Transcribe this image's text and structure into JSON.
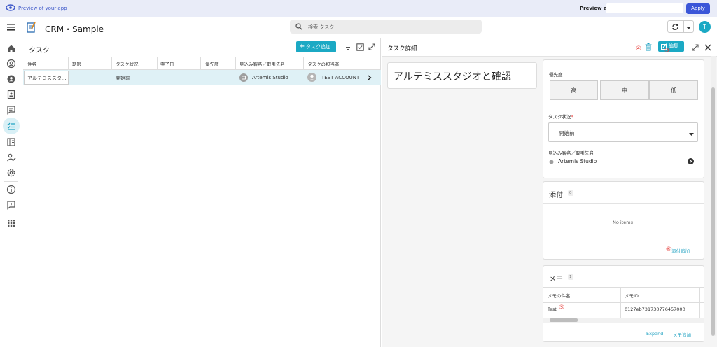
{
  "preview": {
    "text": "Preview of your app",
    "label": "Preview as:",
    "input_value": "",
    "apply": "Apply",
    "accent": "#3b56d8"
  },
  "header": {
    "app_title": "CRM・Sample",
    "search_placeholder": "検索 タスク",
    "avatar_letter": "T",
    "accent": "#1ba9c4"
  },
  "list": {
    "title": "タスク",
    "add_label": "タスク追加",
    "columns": [
      "件名",
      "期限",
      "タスク状況",
      "完了日",
      "優先度",
      "見込み客名／取引先名",
      "タスクの担当者"
    ],
    "rows": [
      {
        "subject": "アルテミススタ...",
        "due": "",
        "status": "開始前",
        "done_date": "",
        "priority": "",
        "account": "Artemis Studio",
        "owner": "TEST ACCOUNT"
      }
    ]
  },
  "detail": {
    "title": "タスク詳細",
    "edit_label": "編集",
    "task_name": "アルテミススタジオと確認",
    "priority_label": "優先度",
    "priority_options": [
      "高",
      "中",
      "低"
    ],
    "status_label": "タスク状況",
    "status_required": "*",
    "status_value": "開始前",
    "account_label": "見込み客名／取引先名",
    "account_value": "Artemis Studio",
    "attach_title": "添付",
    "attach_count": "0",
    "attach_empty": "No items",
    "attach_add": "添付追加",
    "memo_title": "メモ",
    "memo_count": "1",
    "memo_columns": [
      "メモの件名",
      "メモID",
      "\u0000"
    ],
    "memo_rows": [
      {
        "subject": "Test",
        "id": "0127eb731730776457000"
      }
    ],
    "expand": "Expand",
    "memo_add": "メモ追加"
  },
  "markers": {
    "m3": "③",
    "m4": "④",
    "m5": "⑤",
    "m6": "⑥"
  }
}
